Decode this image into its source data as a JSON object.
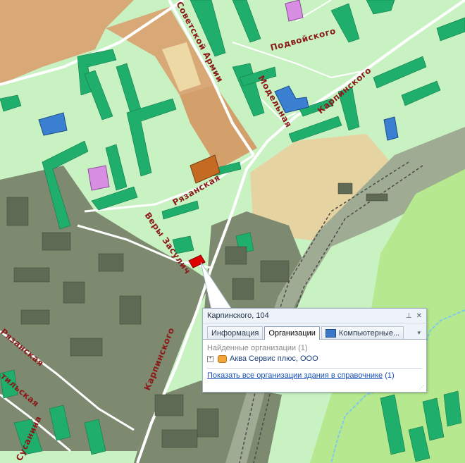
{
  "map": {
    "street_labels": {
      "sovetskoy_armii": "Советской Армии",
      "podvoiskogo": "Подвойского",
      "modelnaya": "Модельная",
      "karpinskogo_ne": "Карпинского",
      "ryazanskaya": "Рязанская",
      "vera_zasulich": "Веры Засулич",
      "karpinskogo_sw": "Карпинского",
      "ryazanskaya_w": "Рязанская",
      "tilskaya": "тильская",
      "susanina": "Сусанина"
    },
    "colors": {
      "residential": "#c9f2c3",
      "industrial": "#7d8a6f",
      "industrial_light": "#a0ab93",
      "building": "#1fae6c",
      "sand": "#e6d3a2",
      "orange": "#d9a877",
      "street_label": "#8b1a1a",
      "highlight_building": "#e00000"
    }
  },
  "popup": {
    "title": "Карпинского, 104",
    "tabs": [
      "Информация",
      "Организации",
      "Компьютерные..."
    ],
    "active_tab": "Организации",
    "found_label": "Найденные организации (1)",
    "org": "Аква Сервис плюс, ООО",
    "link": "Показать все организации здания в справочнике",
    "link_count": "(1)"
  }
}
